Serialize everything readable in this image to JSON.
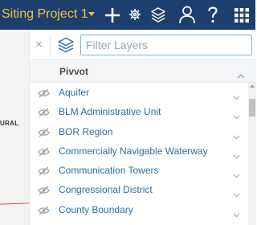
{
  "header": {
    "project_title": "Siting Project 1"
  },
  "map": {
    "label_fragment": "URAL"
  },
  "panel": {
    "close_glyph": "×",
    "search": {
      "value": "",
      "placeholder": "Filter Layers"
    },
    "group": {
      "title": "Pivvot"
    },
    "layers": [
      {
        "label": "Aquifer"
      },
      {
        "label": "BLM Administrative Unit"
      },
      {
        "label": "BOR Region"
      },
      {
        "label": "Commercially Navigable Waterway"
      },
      {
        "label": "Communication Towers"
      },
      {
        "label": "Congressional District"
      },
      {
        "label": "County Boundary"
      }
    ]
  },
  "colors": {
    "topbar_bg": "#1c3f6e",
    "project_title": "#f5c042",
    "link_text": "#2e6da4",
    "input_border": "#7fb3dd"
  },
  "icons": {
    "toolbar": [
      "plus-icon",
      "gear-icon",
      "layers-icon",
      "user-icon",
      "help-icon",
      "grid-icon"
    ],
    "row": [
      "eye-slash-icon",
      "chevron-down-icon"
    ]
  }
}
